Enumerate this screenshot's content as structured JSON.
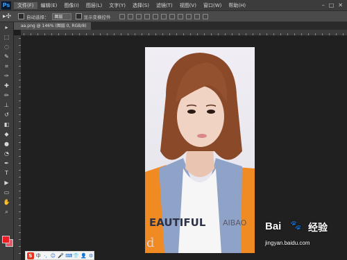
{
  "app": {
    "logo": "Ps"
  },
  "menu": [
    "文件(F)",
    "编辑(E)",
    "图像(I)",
    "图层(L)",
    "文字(Y)",
    "选择(S)",
    "滤镜(T)",
    "视图(V)",
    "窗口(W)",
    "帮助(H)"
  ],
  "window_controls": [
    "–",
    "□",
    "✕"
  ],
  "options_bar": {
    "tool_glyph": "▸✣",
    "auto_select_label": "自动选择：",
    "auto_select_value": "图层",
    "show_transform_label": "显示变换控件"
  },
  "document_tab": {
    "title": "aa.png @ 146% (图层 0, RGB/8)"
  },
  "toolbar_icons": [
    "move-icon",
    "marquee-icon",
    "lasso-icon",
    "quick-select-icon",
    "crop-icon",
    "eyedropper-icon",
    "healing-brush-icon",
    "brush-icon",
    "clone-stamp-icon",
    "history-brush-icon",
    "eraser-icon",
    "paint-bucket-icon",
    "blur-icon",
    "dodge-icon",
    "pen-icon",
    "type-icon",
    "path-select-icon",
    "shape-icon",
    "hand-icon",
    "zoom-icon"
  ],
  "toolbar_glyphs": [
    "▸",
    "⬚",
    "◌",
    "✎",
    "⌗",
    "✑",
    "✚",
    "✏",
    "⊥",
    "↺",
    "◧",
    "◆",
    "●",
    "◔",
    "✒",
    "T",
    "▶",
    "▭",
    "✋",
    "⌕"
  ],
  "colors": {
    "foreground": "#ee1c25",
    "background": "#e35b6b"
  },
  "photo": {
    "shirt_text": "EAUTIFUL",
    "shirt_text_right": "AIBAO",
    "corner_letter": "d"
  },
  "watermark": {
    "brand": "Bai",
    "brand_zh": "经验",
    "url": "jingyan.baidu.com"
  },
  "ime": {
    "logo": "S",
    "lang": "中",
    "icons": [
      "·,",
      "☺",
      "🎤",
      "⌨",
      "👕",
      "👤",
      "⚙"
    ]
  }
}
